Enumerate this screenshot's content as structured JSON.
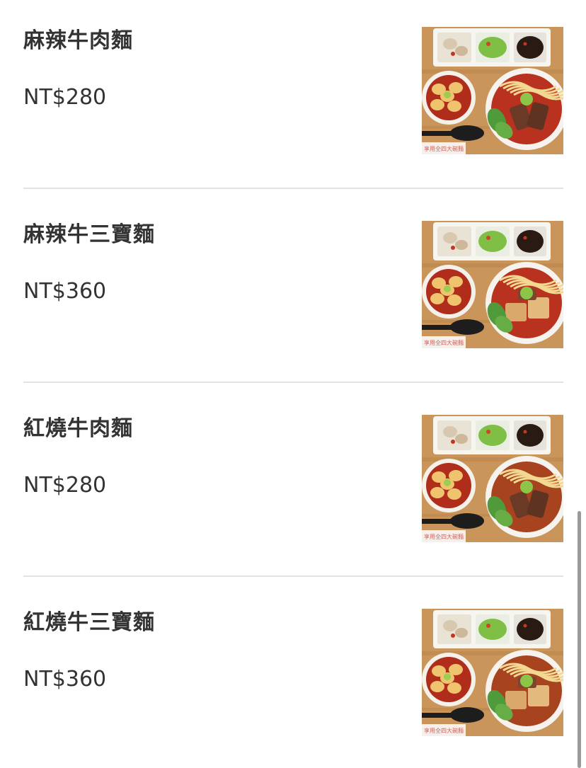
{
  "menu": {
    "items": [
      {
        "name": "麻辣牛肉麵",
        "price": "NT$280",
        "soup": "spicy",
        "topping": "beef",
        "photo_label": "享用全四大碗麵"
      },
      {
        "name": "麻辣牛三寶麵",
        "price": "NT$360",
        "soup": "spicy",
        "topping": "triple",
        "photo_label": "享用全四大碗麵"
      },
      {
        "name": "紅燒牛肉麵",
        "price": "NT$280",
        "soup": "braised",
        "topping": "beef",
        "photo_label": "享用全四大碗麵"
      },
      {
        "name": "紅燒牛三寶麵",
        "price": "NT$360",
        "soup": "braised",
        "topping": "triple",
        "photo_label": "享用全四大碗麵"
      }
    ]
  },
  "colors": {
    "text": "#333333",
    "divider": "#e2e2e2",
    "scrollbar": "#9a9a9a",
    "table_wood": "#c9955a",
    "spicy_broth": "#b8321f",
    "braised_broth": "#a8431f"
  }
}
